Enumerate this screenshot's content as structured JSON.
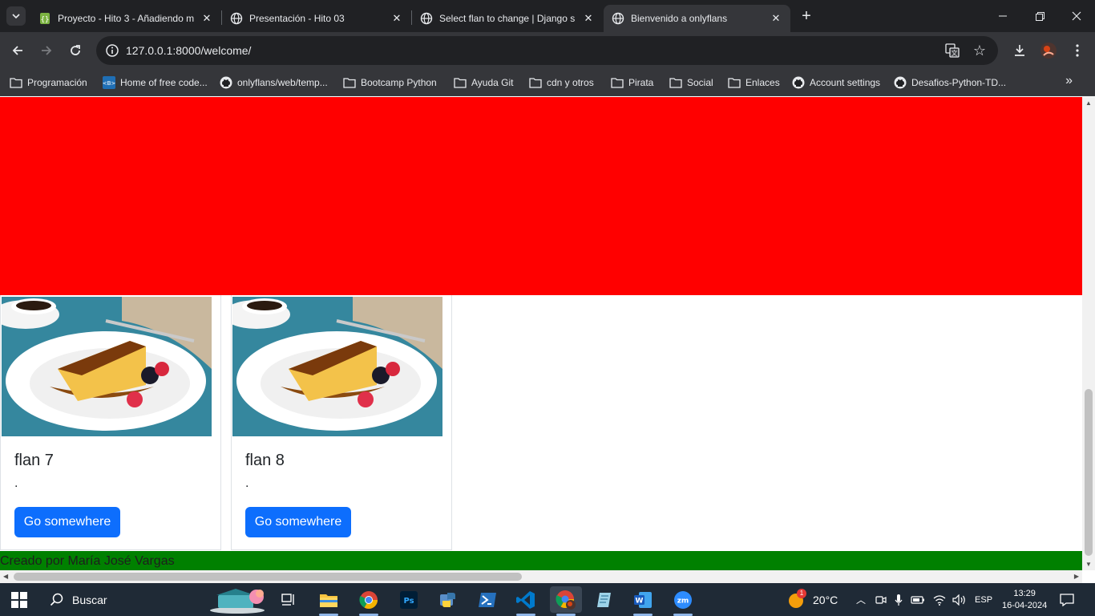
{
  "browser": {
    "tabs": [
      {
        "title": "Proyecto - Hito 3 - Añadiendo m",
        "active": false
      },
      {
        "title": "Presentación - Hito 03",
        "active": false
      },
      {
        "title": "Select flan to change | Django s",
        "active": false
      },
      {
        "title": "Bienvenido a onlyflans",
        "active": true
      }
    ],
    "url": "127.0.0.1:8000/welcome/"
  },
  "bookmarks": [
    {
      "label": "Programación",
      "icon": "folder-icon"
    },
    {
      "label": "Home of free code...",
      "icon": "freecodecamp-icon"
    },
    {
      "label": "onlyflans/web/temp...",
      "icon": "github-icon"
    },
    {
      "label": "Bootcamp Python",
      "icon": "folder-icon"
    },
    {
      "label": "Ayuda Git",
      "icon": "folder-icon"
    },
    {
      "label": "cdn y otros",
      "icon": "folder-icon"
    },
    {
      "label": "Pirata",
      "icon": "folder-icon"
    },
    {
      "label": "Social",
      "icon": "folder-icon"
    },
    {
      "label": "Enlaces",
      "icon": "folder-icon"
    },
    {
      "label": "Account settings",
      "icon": "github-icon"
    },
    {
      "label": "Desafios-Python-TD...",
      "icon": "github-icon"
    }
  ],
  "page": {
    "hero_color": "#ff0000",
    "cards": [
      {
        "title": "flan 7",
        "text": ".",
        "button": "Go somewhere"
      },
      {
        "title": "flan 8",
        "text": ".",
        "button": "Go somewhere"
      }
    ],
    "footer": "Creado por María José Vargas",
    "footer_color": "#008000"
  },
  "taskbar": {
    "search_label": "Buscar",
    "weather": "20°C",
    "weather_badge": "1",
    "language": "ESP",
    "time": "13:29",
    "date": "16-04-2024"
  }
}
